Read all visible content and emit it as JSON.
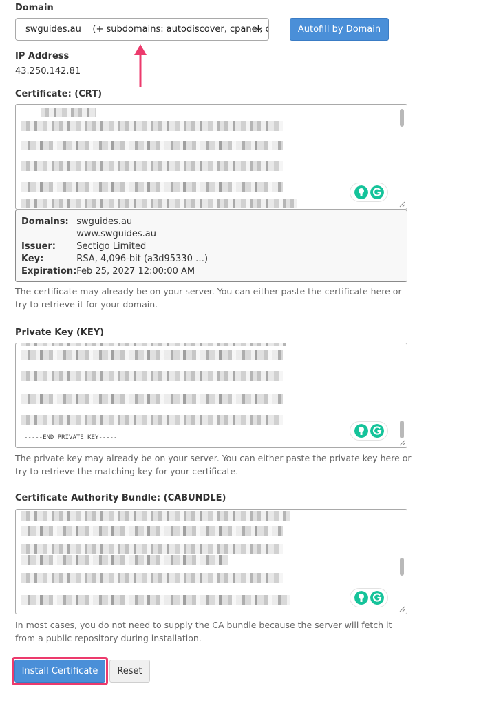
{
  "domain_section": {
    "label": "Domain",
    "selected": "swguides.au    (+ subdomains: autodiscover, cpanel, cpcalendars, cpcontacts, mail, webdisk, webmail, www)",
    "autofill_label": "Autofill by Domain"
  },
  "ip_section": {
    "label": "IP Address",
    "value": "43.250.142.81"
  },
  "certificate": {
    "label": "Certificate: (CRT)",
    "info": {
      "domains_key": "Domains:",
      "domains": [
        "swguides.au",
        "www.swguides.au"
      ],
      "issuer_key": "Issuer:",
      "issuer": "Sectigo Limited",
      "key_key": "Key:",
      "key": "RSA, 4,096-bit (a3d95330 …)",
      "expiration_key": "Expiration:",
      "expiration": "Feb 25, 2027 12:00:00 AM"
    },
    "help": "The certificate may already be on your server. You can either paste the certificate here or try to retrieve it for your domain."
  },
  "private_key": {
    "label": "Private Key (KEY)",
    "end_marker": "-----END PRIVATE KEY-----",
    "help": "The private key may already be on your server. You can either paste the private key here or try to retrieve the matching key for your certificate."
  },
  "cabundle": {
    "label": "Certificate Authority Bundle: (CABUNDLE)",
    "help": "In most cases, you do not need to supply the CA bundle because the server will fetch it from a public repository during installation."
  },
  "actions": {
    "install_label": "Install Certificate",
    "reset_label": "Reset"
  },
  "colors": {
    "primary_button": "#4a8fd8",
    "highlight": "#ec3a6c",
    "grammarly_green": "#15c39a"
  },
  "icons": [
    "chevron-down-icon",
    "arrow-up-icon",
    "grammarly-hint-icon",
    "grammarly-icon",
    "resize-handle-icon"
  ]
}
